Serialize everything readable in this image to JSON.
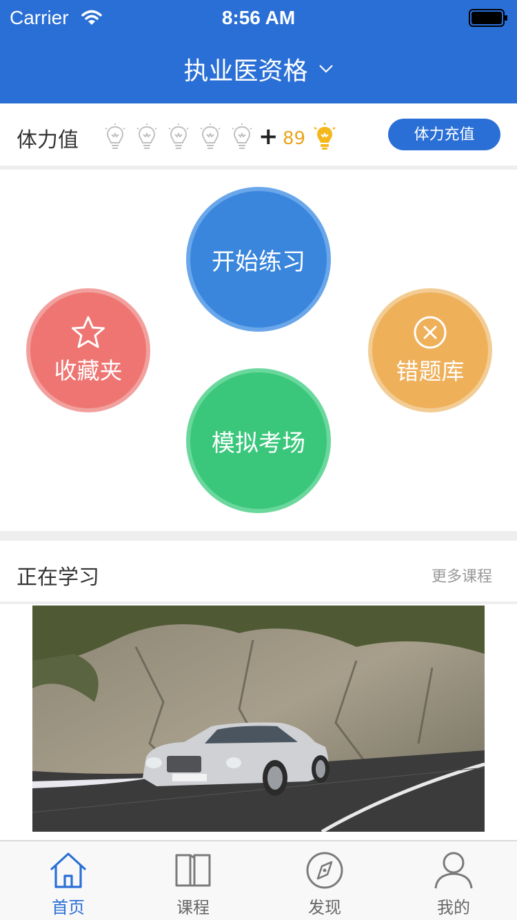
{
  "status_bar": {
    "carrier": "Carrier",
    "time": "8:56 AM"
  },
  "nav": {
    "title": "执业医资格"
  },
  "stamina": {
    "label": "体力值",
    "plus": "+",
    "count": "89",
    "recharge_label": "体力充值"
  },
  "actions": {
    "practice": "开始练习",
    "favorites": "收藏夹",
    "wrong_questions": "错题库",
    "mock_exam": "模拟考场"
  },
  "learning": {
    "title": "正在学习",
    "more": "更多课程"
  },
  "tabs": [
    {
      "label": "首页",
      "icon": "home-icon",
      "active": true
    },
    {
      "label": "课程",
      "icon": "book-icon",
      "active": false
    },
    {
      "label": "发现",
      "icon": "compass-icon",
      "active": false
    },
    {
      "label": "我的",
      "icon": "user-icon",
      "active": false
    }
  ],
  "colors": {
    "brand": "#2a6fd6",
    "practice": "#3a86dd",
    "mock_exam": "#3ac77c",
    "favorites": "#ee7572",
    "wrong_questions": "#efb05a",
    "count": "#e9a51c"
  }
}
